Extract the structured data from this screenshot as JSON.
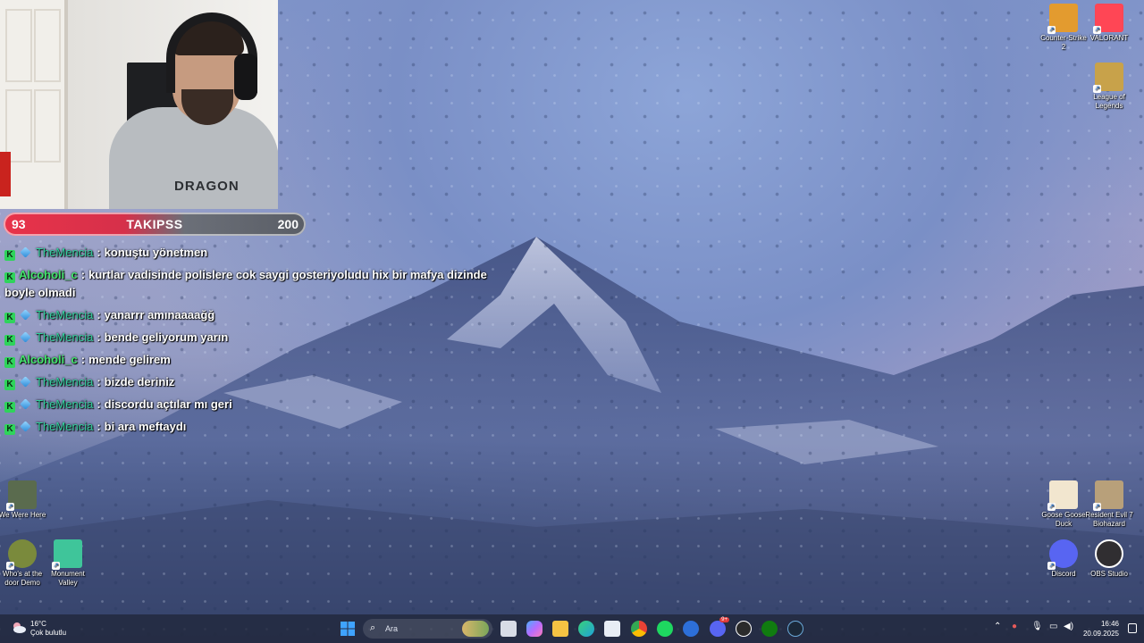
{
  "follower_goal": {
    "current": "93",
    "label": "TAKIPSS",
    "goal": "200"
  },
  "webcam": {
    "shirt_text": "DRAGON"
  },
  "chat": [
    {
      "user": "TheMencia",
      "sep": ":",
      "text": "konuştu yönetmen",
      "badges": [
        "kick",
        "gem"
      ],
      "color": "#35d1a0"
    },
    {
      "user": "Alcoholi_c",
      "sep": ":",
      "text": "kurtlar vadisinde polislere cok saygi gosteriyoludu hix bir mafya dizinde boyle olmadi",
      "badges": [
        "kick"
      ],
      "color": "#43e36c"
    },
    {
      "user": "TheMencia",
      "sep": ":",
      "text": "yanarrr amınaaaağğ",
      "badges": [
        "kick",
        "gem"
      ],
      "color": "#35d1a0"
    },
    {
      "user": "TheMencia",
      "sep": ":",
      "text": "bende geliyorum yarın",
      "badges": [
        "kick",
        "gem"
      ],
      "color": "#35d1a0"
    },
    {
      "user": "Alcoholi_c",
      "sep": ":",
      "text": "mende gelirem",
      "badges": [
        "kick"
      ],
      "color": "#43e36c"
    },
    {
      "user": "TheMencia",
      "sep": ":",
      "text": "bizde deriniz",
      "badges": [
        "kick",
        "gem"
      ],
      "color": "#35d1a0"
    },
    {
      "user": "TheMencia",
      "sep": ":",
      "text": "discordu açtılar mı geri",
      "badges": [
        "kick",
        "gem"
      ],
      "color": "#35d1a0"
    },
    {
      "user": "TheMencia",
      "sep": ":",
      "text": "bi ara meftaydı",
      "badges": [
        "kick",
        "gem"
      ],
      "color": "#35d1a0"
    }
  ],
  "desktop_icons": {
    "cs2": {
      "label": "Counter-Strike 2",
      "icon": "counter-strike-icon",
      "color": "#e39b2f"
    },
    "valorant": {
      "label": "VALORANT",
      "icon": "valorant-icon",
      "color": "#ff4655"
    },
    "lol": {
      "label": "League of Legends",
      "icon": "league-of-legends-icon",
      "color": "#c8a24a"
    },
    "we_were_here": {
      "label": "We Were Here",
      "icon": "we-were-here-icon",
      "color": "#5a6b4e"
    },
    "whos_at_door": {
      "label": "Who's at the door Demo",
      "icon": "whos-at-the-door-icon",
      "color": "#7a8a3c"
    },
    "monument_valley": {
      "label": "Monument Valley",
      "icon": "monument-valley-icon",
      "color": "#3fc59a"
    },
    "goose_goose_duck": {
      "label": "Goose Goose Duck",
      "icon": "goose-goose-duck-icon",
      "color": "#f2e6cf"
    },
    "resident_evil": {
      "label": "Resident Evil 7 Biohazard",
      "icon": "resident-evil-icon",
      "color": "#b8a07a"
    },
    "discord": {
      "label": "Discord",
      "icon": "discord-icon",
      "color": "#5865f2"
    },
    "obs": {
      "label": "OBS Studio",
      "icon": "obs-studio-icon",
      "color": "#302e31"
    }
  },
  "taskbar": {
    "weather_temp": "16°C",
    "weather_desc": "Çok bulutlu",
    "search_placeholder": "Ara",
    "time": "16:46",
    "date": "20.09.2025",
    "pinned": [
      {
        "name": "start",
        "icon": "windows-start-icon",
        "color": "#3fa3ff"
      },
      {
        "name": "task-view",
        "icon": "task-view-icon",
        "color": "#d8dce6"
      },
      {
        "name": "copilot",
        "icon": "copilot-icon",
        "color": "#b56cff"
      },
      {
        "name": "file-explorer",
        "icon": "folder-icon",
        "color": "#f6c343"
      },
      {
        "name": "edge",
        "icon": "edge-icon",
        "color": "#1fa2d9"
      },
      {
        "name": "store",
        "icon": "store-icon",
        "color": "#e8edf5"
      },
      {
        "name": "chrome",
        "icon": "chrome-icon",
        "color": "#e94235"
      },
      {
        "name": "spotify",
        "icon": "spotify-icon",
        "color": "#1ed760"
      },
      {
        "name": "vpn",
        "icon": "network-app-icon",
        "color": "#2d6fd8"
      },
      {
        "name": "discord",
        "icon": "discord-icon",
        "color": "#5865f2"
      },
      {
        "name": "obs",
        "icon": "obs-studio-icon",
        "color": "#2b2b2b"
      },
      {
        "name": "xbox",
        "icon": "xbox-icon",
        "color": "#107c10"
      },
      {
        "name": "steam",
        "icon": "steam-icon",
        "color": "#1b2838"
      }
    ],
    "discord_badge": "9+"
  }
}
